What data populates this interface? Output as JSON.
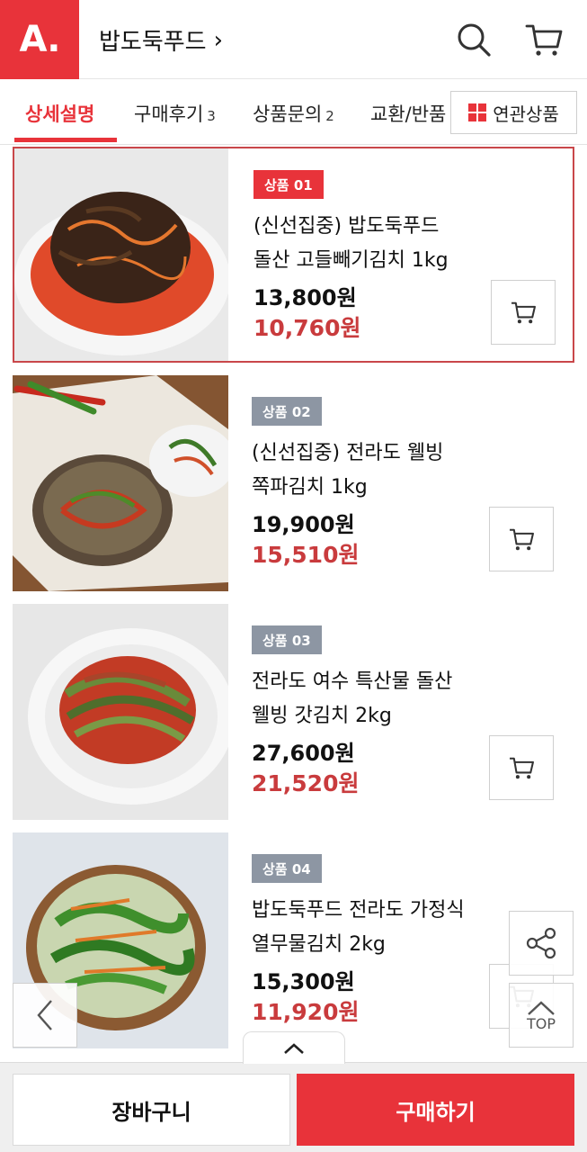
{
  "header": {
    "logo": "A.",
    "store_name": "밥도둑푸드",
    "store_chevron": "›",
    "icons": [
      "search-icon",
      "cart-icon"
    ]
  },
  "tabs": {
    "items": [
      {
        "label": "상세설명",
        "count": ""
      },
      {
        "label": "구매후기",
        "count": "3"
      },
      {
        "label": "상품문의",
        "count": "2"
      }
    ],
    "clipped_tab": "교환/반품",
    "related_button": "연관상품"
  },
  "products": [
    {
      "badge": "상품 01",
      "name_line1": "(신선집중) 밥도둑푸드",
      "name_line2": "돌산 고들빼기김치 1kg",
      "price": "13,800원",
      "sale_price": "10,760원"
    },
    {
      "badge": "상품 02",
      "name_line1": "(신선집중) 전라도 웰빙",
      "name_line2": "쪽파김치 1kg",
      "price": "19,900원",
      "sale_price": "15,510원"
    },
    {
      "badge": "상품 03",
      "name_line1": "전라도 여수 특산물 돌산",
      "name_line2": "웰빙 갓김치 2kg",
      "price": "27,600원",
      "sale_price": "21,520원"
    },
    {
      "badge": "상품 04",
      "name_line1": "밥도둑푸드 전라도 가정식",
      "name_line2": "열무물김치 2kg",
      "price": "15,300원",
      "sale_price": "11,920원"
    }
  ],
  "floating": {
    "top_label": "TOP",
    "icons": [
      "share-icon",
      "chevron-up-icon",
      "chevron-left-icon"
    ]
  },
  "bottom": {
    "cart_label": "장바구니",
    "buy_label": "구매하기"
  },
  "colors": {
    "brand": "#e8333a",
    "sale_price": "#c93b3d",
    "badge_gray": "#8d96a3"
  }
}
